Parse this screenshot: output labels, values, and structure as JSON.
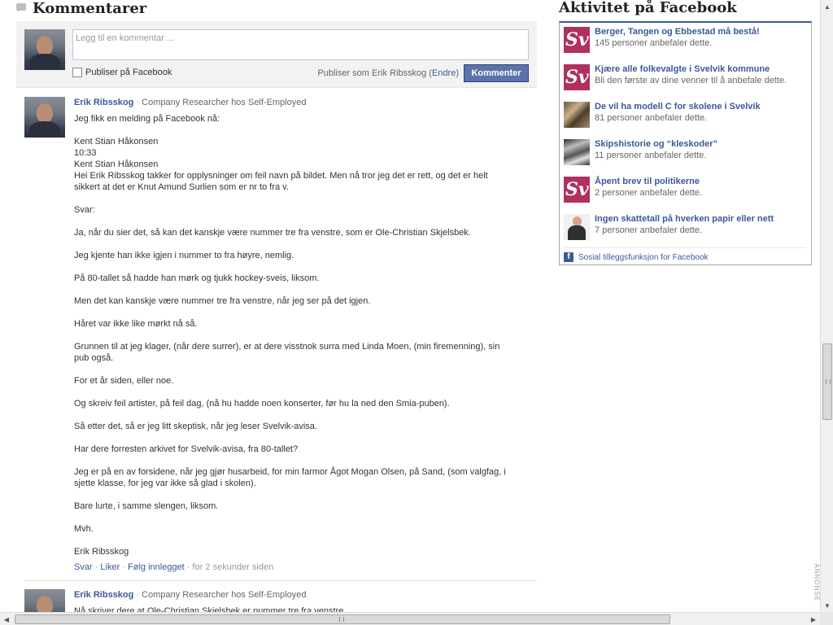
{
  "comments_section": {
    "title": "Kommentarer"
  },
  "composer": {
    "placeholder": "Legg til en kommentar ...",
    "publish_checkbox_label": "Publiser på Facebook",
    "publish_as_prefix": "Publiser som Erik Ribsskog (",
    "change_link": "Endre",
    "publish_as_suffix": ")",
    "submit_label": "Kommenter"
  },
  "comments": [
    {
      "author": "Erik Ribsskog",
      "separator": " · ",
      "role": "Company Researcher hos Self-Employed",
      "lines": [
        "Jeg fikk en melding på Facebook nå:",
        "Kent Stian Håkonsen",
        "10:33",
        "Kent Stian Håkonsen",
        "Hei Erik Ribsskog takker for opplysninger om feil navn på bildet. Men nå tror jeg det er rett, og det er helt sikkert at det er Knut Amund Surlien som er nr to fra v.",
        "Svar:",
        "Ja, når du sier det, så kan det kanskje være nummer tre fra venstre, som er Ole-Christian Skjelsbek.",
        "Jeg kjente han ikke igjen i nummer to fra høyre, nemlig.",
        "På 80-tallet så hadde han mørk og tjukk hockey-sveis, liksom.",
        "Men det kan kanskje være nummer tre fra venstre, når jeg ser på det igjen.",
        "Håret var ikke like mørkt nå så.",
        "Grunnen til at jeg klager, (når dere surrer), er at dere visstnok surra med Linda Moen, (min firemenning), sin pub også.",
        "For et år siden, eller noe.",
        "Og skreiv feil artister, på feil dag, (nå hu hadde noen konserter, før hu la ned den Smia-puben).",
        "Så etter det, så er jeg litt skeptisk, når jeg leser Svelvik-avisa.",
        "Har dere forresten arkivet for Svelvik-avisa, fra 80-tallet?",
        "Jeg er på en av forsidene, når jeg gjør husarbeid, for min farmor Ågot Mogan Olsen, på Sand, (som valgfag, i sjette klasse, for jeg var ikke så glad i skolen).",
        "Bare lurte, i samme slengen, liksom.",
        "Mvh.",
        "Erik Ribsskog"
      ],
      "actions": {
        "reply": "Svar",
        "like": "Liker",
        "follow": "Følg innlegget",
        "dot": " · ",
        "time": "for 2 sekunder siden"
      }
    },
    {
      "author": "Erik Ribsskog",
      "separator": " · ",
      "role": "Company Researcher hos Self-Employed",
      "first_line": "Nå skriver dere at Ole-Christian Skjelsbek er nummer tre fra venstre."
    }
  ],
  "facebook_activity": {
    "title": "Aktivitet på Facebook",
    "logo_text": "Sv",
    "items": [
      {
        "title": "Berger, Tangen og Ebbestad må bestå!",
        "subtitle": "145 personer anbefaler dette."
      },
      {
        "title": "Kjære alle folkevalgte i Svelvik kommune",
        "subtitle": "Bli den første av dine venner til å anbefale dette."
      },
      {
        "title": "De vil ha modell C for skolene i Svelvik",
        "subtitle": "81 personer anbefaler dette."
      },
      {
        "title": "Skipshistorie og “kleskoder”",
        "subtitle": "11 personer anbefaler dette."
      },
      {
        "title": "Åpent brev til politikerne",
        "subtitle": "2 personer anbefaler dette."
      },
      {
        "title": "Ingen skattetall på hverken papir eller nett",
        "subtitle": "7 personer anbefaler dette."
      }
    ],
    "footer_icon": "f",
    "footer": "Sosial tilleggsfunksjon for Facebook"
  },
  "ad_label": "ANNONSE",
  "colors": {
    "link": "#3b5998",
    "button": "#5b74a8",
    "brand_logo": "#b0305f"
  },
  "icons": {
    "section": "speech-bubble-icon",
    "facebook": "facebook-icon",
    "scroll_up": "arrow-up-icon",
    "scroll_down": "arrow-down-icon",
    "scroll_left": "arrow-left-icon",
    "scroll_right": "arrow-right-icon"
  }
}
